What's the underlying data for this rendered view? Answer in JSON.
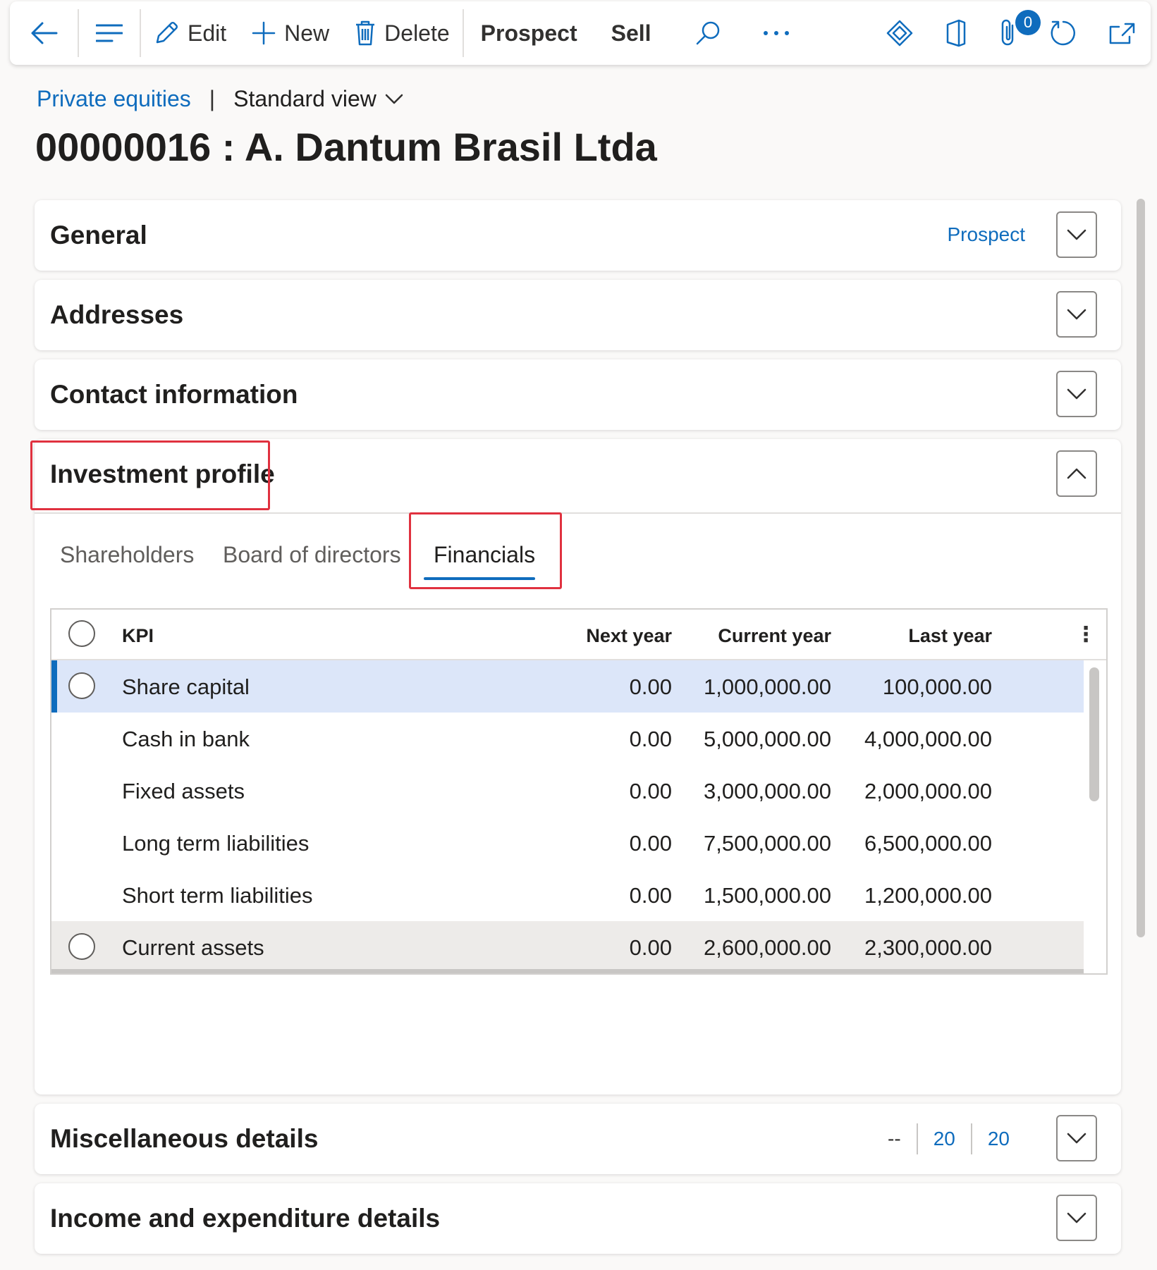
{
  "toolbar": {
    "edit_label": "Edit",
    "new_label": "New",
    "delete_label": "Delete",
    "prospect_label": "Prospect",
    "sell_label": "Sell",
    "attachments_count": "0"
  },
  "breadcrumb": {
    "module": "Private equities",
    "separator": "|",
    "view": "Standard view"
  },
  "page_title": "00000016 : A. Dantum Brasil Ltda",
  "sections": {
    "general": {
      "title": "General",
      "status": "Prospect"
    },
    "addresses": {
      "title": "Addresses"
    },
    "contact": {
      "title": "Contact information"
    },
    "investment": {
      "title": "Investment profile"
    },
    "misc": {
      "title": "Miscellaneous details",
      "values": [
        "--",
        "20",
        "20"
      ]
    },
    "income": {
      "title": "Income and expenditure details"
    }
  },
  "tabs": [
    {
      "label": "Shareholders"
    },
    {
      "label": "Board of directors"
    },
    {
      "label": "Financials"
    }
  ],
  "grid": {
    "columns": {
      "kpi": "KPI",
      "next": "Next year",
      "current": "Current year",
      "last": "Last year"
    },
    "rows": [
      {
        "kpi": "Share capital",
        "next": "0.00",
        "current": "1,000,000.00",
        "last": "100,000.00"
      },
      {
        "kpi": "Cash in bank",
        "next": "0.00",
        "current": "5,000,000.00",
        "last": "4,000,000.00"
      },
      {
        "kpi": "Fixed assets",
        "next": "0.00",
        "current": "3,000,000.00",
        "last": "2,000,000.00"
      },
      {
        "kpi": "Long term liabilities",
        "next": "0.00",
        "current": "7,500,000.00",
        "last": "6,500,000.00"
      },
      {
        "kpi": "Short term liabilities",
        "next": "0.00",
        "current": "1,500,000.00",
        "last": "1,200,000.00"
      },
      {
        "kpi": "Current assets",
        "next": "0.00",
        "current": "2,600,000.00",
        "last": "2,300,000.00"
      }
    ]
  },
  "colors": {
    "accent": "#0f6cbd",
    "highlight_box": "#e0313f",
    "selected_row": "#dce6f9"
  }
}
